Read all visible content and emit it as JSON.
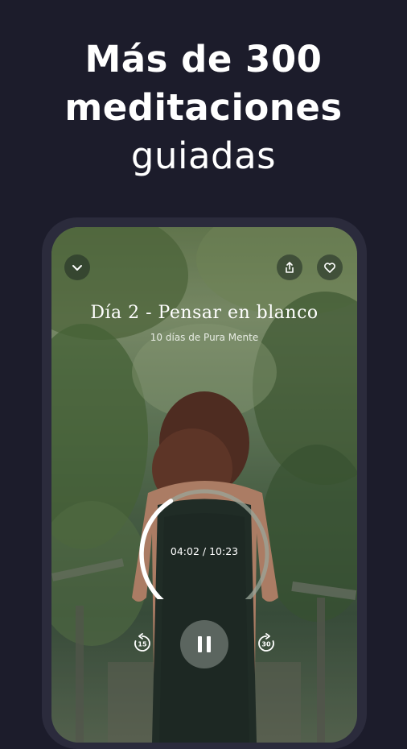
{
  "headline": {
    "line1": "Más de 300",
    "line2": "meditaciones",
    "line3": "guiadas"
  },
  "player": {
    "title": "Día 2 - Pensar en blanco",
    "subtitle": "10 días de Pura Mente",
    "time_label": "04:02 / 10:23",
    "progress": 0.389,
    "rewind_seconds": "15",
    "forward_seconds": "30",
    "icons": {
      "collapse": "chevron-down-icon",
      "share": "share-icon",
      "favorite": "heart-icon",
      "pause": "pause-icon",
      "rewind": "rewind-15-icon",
      "forward": "forward-30-icon"
    }
  },
  "colors": {
    "background": "#1c1c2b",
    "text": "#ffffff",
    "progress_active": "#ffffff",
    "progress_track": "#9aa59a"
  }
}
